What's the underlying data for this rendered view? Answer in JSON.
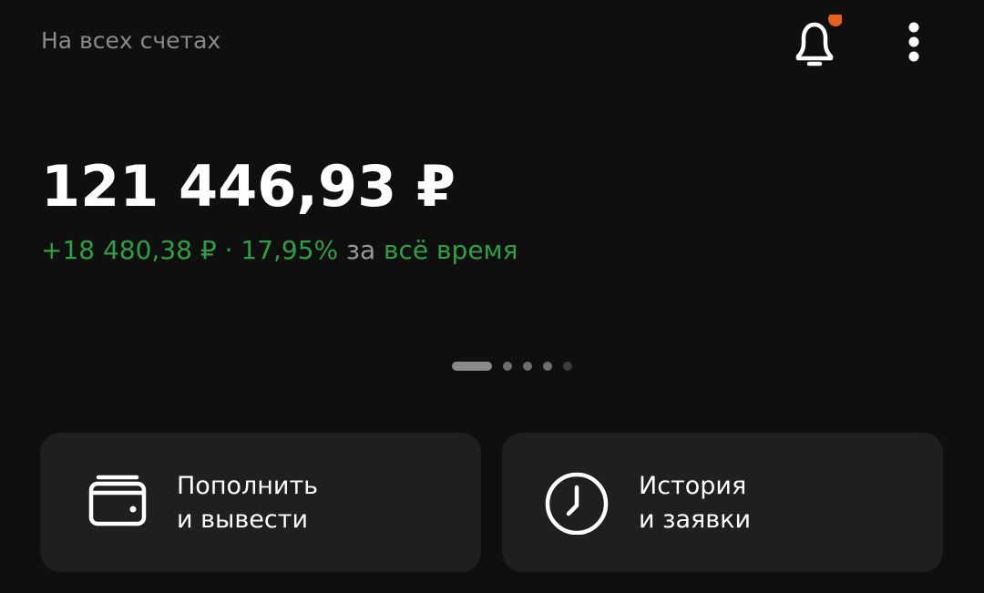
{
  "header": {
    "account_label": "На всех счетах",
    "notification_badge_color": "#e8601c"
  },
  "portfolio": {
    "balance": "121 446,93 ₽",
    "change_amount": "+18 480,38 ₽",
    "separator": " · ",
    "change_percent": "17,95%",
    "period_prefix": " за ",
    "period": "всё время",
    "positive_color": "#2ea043"
  },
  "pager": {
    "pages": 5,
    "active_index": 0
  },
  "actions": [
    {
      "icon": "wallet-icon",
      "label_line1": "Пополнить",
      "label_line2": "и вывести"
    },
    {
      "icon": "clock-icon",
      "label_line1": "История",
      "label_line2": "и заявки"
    }
  ]
}
